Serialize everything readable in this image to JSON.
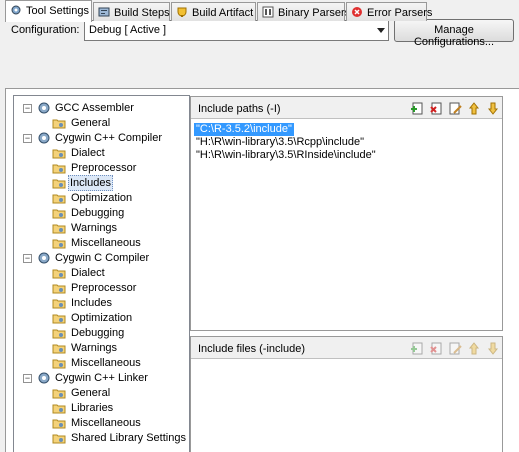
{
  "config": {
    "label": "Configuration:",
    "selected": "Debug  [ Active ]",
    "manage_button": "Manage Configurations..."
  },
  "tabs": [
    {
      "label": "Tool Settings",
      "icon": "gear-icon",
      "active": true
    },
    {
      "label": "Build Steps",
      "icon": "build-steps-icon",
      "active": false
    },
    {
      "label": "Build Artifact",
      "icon": "build-artifact-icon",
      "active": false
    },
    {
      "label": "Binary Parsers",
      "icon": "binary-parsers-icon",
      "active": false
    },
    {
      "label": "Error Parsers",
      "icon": "error-parsers-icon",
      "active": false
    }
  ],
  "tree": {
    "groups": [
      {
        "label": "GCC Assembler",
        "children": [
          "General"
        ]
      },
      {
        "label": "Cygwin C++ Compiler",
        "children": [
          "Dialect",
          "Preprocessor",
          "Includes",
          "Optimization",
          "Debugging",
          "Warnings",
          "Miscellaneous"
        ]
      },
      {
        "label": "Cygwin C Compiler",
        "children": [
          "Dialect",
          "Preprocessor",
          "Includes",
          "Optimization",
          "Debugging",
          "Warnings",
          "Miscellaneous"
        ]
      },
      {
        "label": "Cygwin C++ Linker",
        "children": [
          "General",
          "Libraries",
          "Miscellaneous",
          "Shared Library Settings"
        ]
      }
    ],
    "selected": "Cygwin C++ Compiler / Includes"
  },
  "include_paths": {
    "title": "Include paths (-I)",
    "items": [
      "\"C:\\R-3.5.2\\include\"",
      "\"H:\\R\\win-library\\3.5\\Rcpp\\include\"",
      "\"H:\\R\\win-library\\3.5\\RInside\\include\""
    ],
    "selected_index": 0,
    "toolbar": [
      "add-icon",
      "delete-icon",
      "edit-icon",
      "move-up-icon",
      "move-down-icon"
    ]
  },
  "include_files": {
    "title": "Include files (-include)",
    "items": [],
    "toolbar": [
      "add-icon",
      "delete-icon",
      "edit-icon",
      "move-up-icon",
      "move-down-icon"
    ]
  },
  "colors": {
    "selection": "#3399ff",
    "tree_selection": "#dce8f7"
  }
}
